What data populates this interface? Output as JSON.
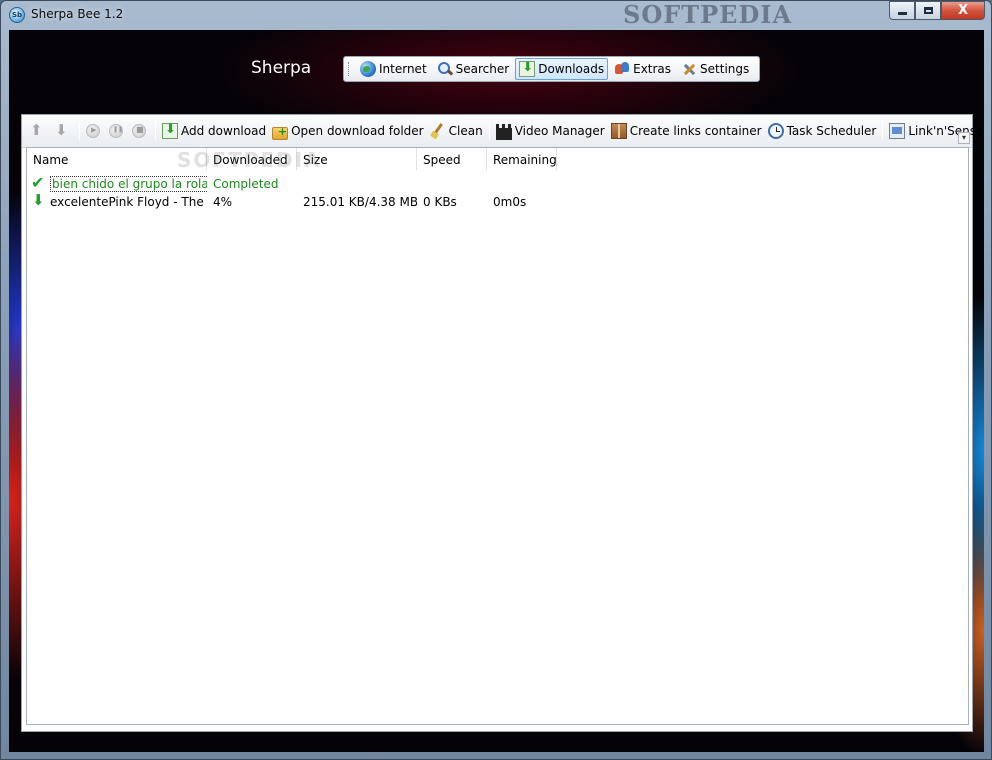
{
  "window": {
    "title": "Sherpa Bee 1.2",
    "watermark": "SOFTPEDIA",
    "buttons": {
      "close_glyph": "X"
    }
  },
  "brand": "Sherpa",
  "nav": {
    "tabs": [
      {
        "label": "Internet",
        "icon": "globe-icon"
      },
      {
        "label": "Searcher",
        "icon": "magnifier-icon"
      },
      {
        "label": "Downloads",
        "icon": "download-icon",
        "active": true
      },
      {
        "label": "Extras",
        "icon": "people-icon"
      },
      {
        "label": "Settings",
        "icon": "tools-icon"
      }
    ]
  },
  "toolbar": {
    "add_download": "Add download",
    "open_folder": "Open download folder",
    "clean": "Clean",
    "video_manager": "Video Manager",
    "links_container": "Create links container",
    "task_scheduler": "Task Scheduler",
    "link_sensor": "Link'n'Sensor",
    "overflow_glyph": "▾"
  },
  "list": {
    "columns": {
      "name": "Name",
      "downloaded": "Downloaded",
      "size": "Size",
      "speed": "Speed",
      "remaining": "Remaining"
    },
    "rows": [
      {
        "icon": "checkmark-icon",
        "name": "bien chido el grupo la rola i...",
        "downloaded": "Completed",
        "size": "",
        "speed": "",
        "remaining": ""
      },
      {
        "icon": "down-arrow-icon",
        "name": "excelentePink Floyd - The Gr...",
        "downloaded": "4%",
        "size": "215.01 KB/4.38 MB",
        "speed": "0 KBs",
        "remaining": "0m0s"
      }
    ],
    "watermark": "SOFTPEDIA"
  },
  "colors": {
    "completed_text": "#1d8a1d",
    "active_tab_bg": "#cfe6fb",
    "close_button": "#c3361f"
  }
}
